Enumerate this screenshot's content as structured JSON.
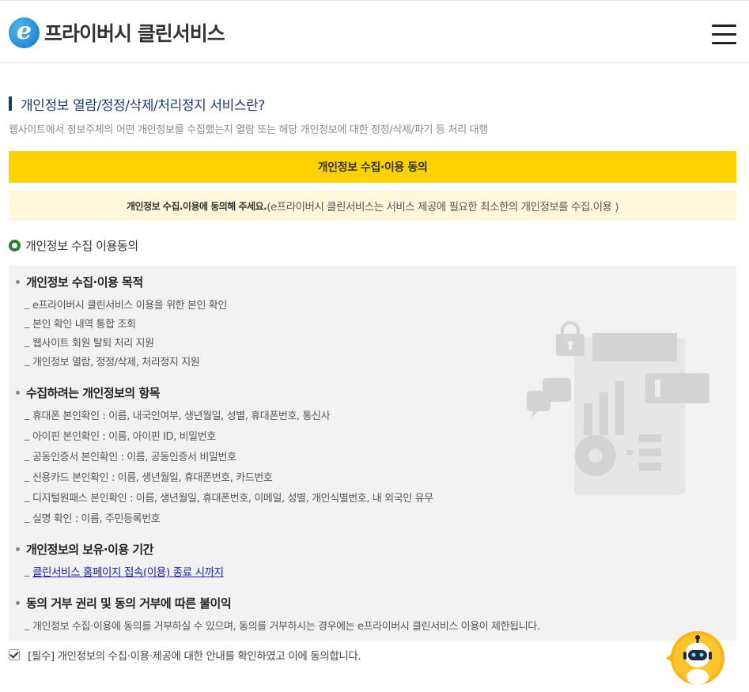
{
  "header": {
    "logo_mark": "e",
    "logo_text": "프라이버시 클린서비스"
  },
  "section": {
    "title": "개인정보 열람/정정/삭제/처리정지 서비스란?",
    "description": "웹사이트에서 정보주체의 어떤 개인정보를 수집했는지 열람 또는 해당 개인정보에 대한 정정/삭제/파기 등 처리 대행"
  },
  "consent_button": "개인정보 수집·이용 동의",
  "notice": {
    "bold": "개인정보 수집.이용에 동의해 주세요.",
    "normal": "(e프라이버시 클린서비스는 서비스 제공에 필요한 최소한의 개인정보를 수집.이용 )"
  },
  "radio_label": "개인정보 수집 이용동의",
  "purpose": {
    "title": "개인정보 수집·이용 목적",
    "items": [
      "e프라이버시 클린서비스 이용을 위한 본인 확인",
      "본인 확인 내역 통합 조회",
      "웹사이트 회원 탈퇴 처리 지원",
      "개인정보 열람, 정정/삭제, 처리정지 지원"
    ]
  },
  "items_collected": {
    "title": "수집하려는 개인정보의 항목",
    "items": [
      "휴대폰 본인확인 : 이름, 내국인여부, 생년월일, 성별, 휴대폰번호, 통신사",
      "아이핀 본인확인 : 이름, 아이핀 ID, 비밀번호",
      "공동인증서 본인확인 : 이름, 공동인증서 비밀번호",
      "신용카드 본인확인 : 이름, 생년월일, 휴대폰번호, 카드번호",
      "디지털원패스 본인확인 : 이름, 생년월일, 휴대폰번호, 이메일, 성별, 개인식별번호, 내 외국인 유무",
      "실명 확인 : 이름, 주민등록번호"
    ]
  },
  "retention": {
    "title": "개인정보의 보유·이용 기간",
    "link": "클린서비스 홈페이지 접속(이용) 종료 시까지"
  },
  "refusal": {
    "title": "동의 거부 권리 및 동의 거부에 따른 불이익",
    "text": "개인정보 수집·이용에 동의를 거부하실 수 있으며, 동의를 거부하시는 경우에는 e프라이버시 클린서비스 이용이 제한됩니다."
  },
  "agree_label": "[필수] 개인정보의 수집·이용·제공에 대한 안내를 확인하였고 이에 동의합니다.",
  "colors": {
    "accent_yellow": "#fed200",
    "notice_bg": "#fef7d9",
    "title_navy": "#1b3a6b",
    "radio_green": "#2e7d32",
    "box_bg": "#f2f2f2",
    "link_blue": "#1a1aa6"
  },
  "icons": [
    "logo-e-icon",
    "hamburger-menu-icon",
    "radio-checked-icon",
    "privacy-document-illustration",
    "checkbox-checked-icon",
    "chatbot-icon"
  ]
}
